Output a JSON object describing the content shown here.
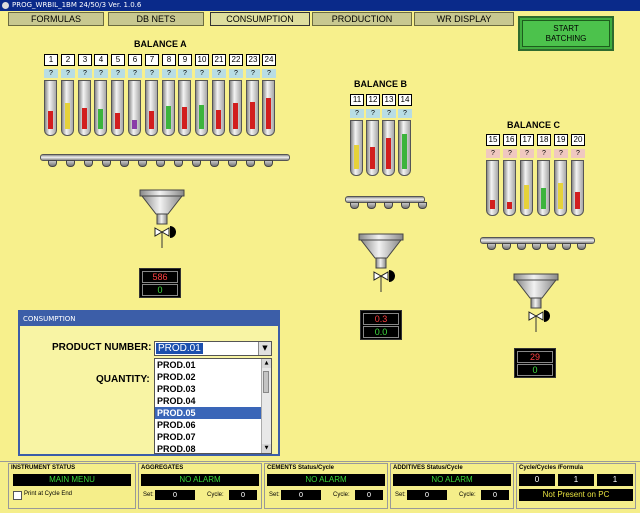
{
  "window": {
    "title": "PROG_WRBIL_1BM 24/50/3  Ver. 1.0.6"
  },
  "nav": [
    {
      "label": "FORMULAS"
    },
    {
      "label": "DB NETS"
    },
    {
      "label": "CONSUMPTION"
    },
    {
      "label": "PRODUCTION"
    },
    {
      "label": "WR DISPLAY"
    }
  ],
  "start_button": {
    "line1": "START",
    "line2": "BATCHING"
  },
  "balances": {
    "a": {
      "title": "BALANCE A",
      "silos": [
        "1",
        "2",
        "3",
        "4",
        "5",
        "6",
        "7",
        "8",
        "9",
        "10",
        "21",
        "22",
        "23",
        "24"
      ],
      "status": "?",
      "readout_top": "586",
      "readout_bottom": "0"
    },
    "b": {
      "title": "BALANCE B",
      "silos": [
        "11",
        "12",
        "13",
        "14"
      ],
      "status": "?",
      "readout_top": "0.3",
      "readout_bottom": "0.0"
    },
    "c": {
      "title": "BALANCE C",
      "silos": [
        "15",
        "16",
        "17",
        "18",
        "19",
        "20"
      ],
      "status": "?",
      "readout_top": "29",
      "readout_bottom": "0"
    }
  },
  "colors": {
    "level_red": "#d21e1e",
    "level_green": "#3cb43c",
    "level_yellow": "#e6d23a",
    "level_purple": "#8a3aa8",
    "nav_active": "#dede9e",
    "start_green": "#4cc24c"
  },
  "dialog": {
    "title": "CONSUMPTION",
    "product_label": "PRODUCT NUMBER:",
    "quantity_label": "QUANTITY:",
    "selected_value": "PROD.01",
    "options": [
      "PROD.01",
      "PROD.02",
      "PROD.03",
      "PROD.04",
      "PROD.05",
      "PROD.06",
      "PROD.07",
      "PROD.08"
    ],
    "highlighted": "PROD.05"
  },
  "status_bar": {
    "instrument": {
      "title": "INSTRUMENT STATUS",
      "value": "MAIN MENU",
      "print_label": "Print at Cycle End"
    },
    "aggregates": {
      "title": "AGGREGATES",
      "alarm": "NO ALARM",
      "set_label": "Set:",
      "set_value": "0",
      "cycle_label": "Cycle:",
      "cycle_value": "0"
    },
    "cements": {
      "title": "CEMENTS Status/Cycle",
      "alarm": "NO ALARM",
      "set_label": "Set:",
      "set_value": "0",
      "cycle_label": "Cycle:",
      "cycle_value": "0"
    },
    "additives": {
      "title": "ADDITIVES Status/Cycle",
      "alarm": "NO ALARM",
      "set_label": "Set:",
      "set_value": "0",
      "cycle_label": "Cycle:",
      "cycle_value": "0"
    },
    "cycles": {
      "title": "Cycle/Cycles /Formula",
      "v1": "0",
      "v2": "1",
      "v3": "1",
      "pc_status": "Not Present on PC"
    }
  }
}
